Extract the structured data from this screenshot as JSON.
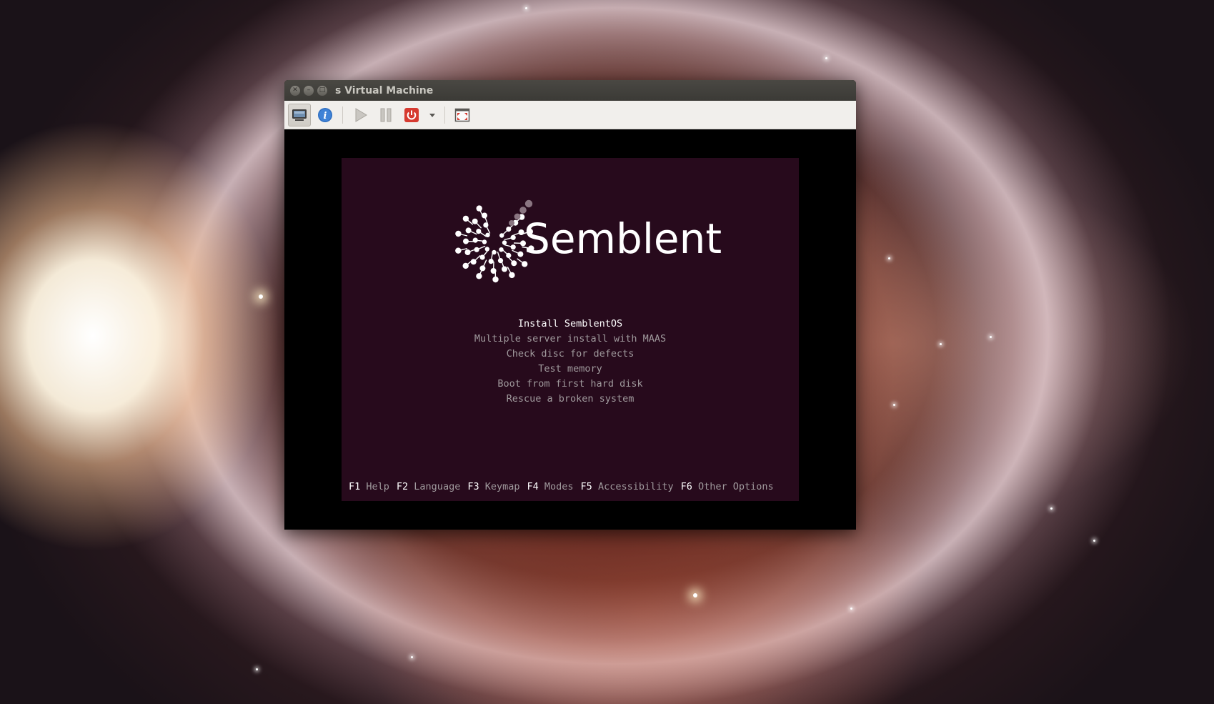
{
  "window": {
    "title": "s Virtual Machine",
    "controls": [
      "close",
      "minimize",
      "maximize"
    ]
  },
  "toolbar": {
    "buttons": [
      {
        "name": "show-console",
        "icon": "monitor-icon",
        "active": true
      },
      {
        "name": "show-details",
        "icon": "info-icon",
        "active": false
      },
      {
        "name": "run",
        "icon": "play-icon",
        "active": false
      },
      {
        "name": "pause",
        "icon": "pause-icon",
        "active": false
      },
      {
        "name": "shutdown",
        "icon": "power-icon",
        "active": false
      },
      {
        "name": "shutdown-menu",
        "icon": "chevron-down-icon",
        "active": false
      },
      {
        "name": "fullscreen",
        "icon": "fullscreen-icon",
        "active": false
      }
    ]
  },
  "boot": {
    "logo_text": "Semblent",
    "menu": [
      {
        "label": "Install SemblentOS",
        "selected": true
      },
      {
        "label": "Multiple server install with MAAS",
        "selected": false
      },
      {
        "label": "Check disc for defects",
        "selected": false
      },
      {
        "label": "Test memory",
        "selected": false
      },
      {
        "label": "Boot from first hard disk",
        "selected": false
      },
      {
        "label": "Rescue a broken system",
        "selected": false
      }
    ],
    "fkeys": [
      {
        "key": "F1",
        "label": "Help"
      },
      {
        "key": "F2",
        "label": "Language"
      },
      {
        "key": "F3",
        "label": "Keymap"
      },
      {
        "key": "F4",
        "label": "Modes"
      },
      {
        "key": "F5",
        "label": "Accessibility"
      },
      {
        "key": "F6",
        "label": "Other Options"
      }
    ]
  },
  "colors": {
    "boot_background": "#270a1c",
    "menu_text": "#a09a9d",
    "menu_selected": "#ffffff",
    "power_red": "#d63a30",
    "info_blue": "#2f6fc2"
  }
}
